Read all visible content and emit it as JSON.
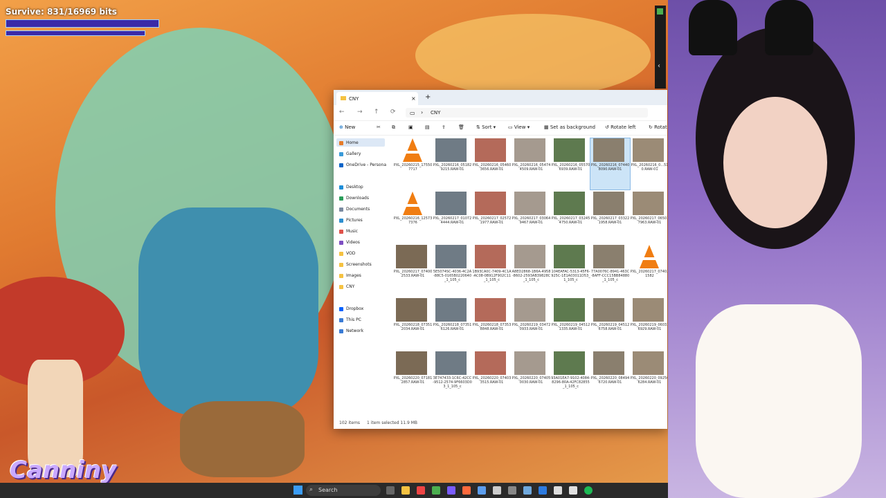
{
  "overlay": {
    "survive_text": "Survive: 831/16969 bits",
    "logo": "Canniny"
  },
  "explorer": {
    "tab_title": "CNY",
    "address": "CNY",
    "toolbar": [
      "New",
      "Sort",
      "View",
      "Set as background",
      "Rotate left",
      "Rotat"
    ],
    "sidebar": [
      "Home",
      "Gallery",
      "OneDrive - Persona",
      "Desktop",
      "Downloads",
      "Documents",
      "Pictures",
      "Music",
      "Videos",
      "VOD",
      "Screenshots",
      "Images",
      "CNY",
      "Dropbox",
      "This PC",
      "Network"
    ],
    "files": [
      "PXL_20260215_175507717",
      "PXL_20260216_051829215.RAW-01",
      "PXL_20260216_054603656.RAW-01",
      "PXL_20260216_054744509.RAW-01",
      "PXL_20260216_055706939.RAW-01",
      "PXL_20260216_074408090.RAW-01",
      "PXL_20260216_0...510.RAW-01",
      "PXL_20260216_125737376",
      "PXL_20260217_010724444.RAW-01",
      "PXL_20260217_025721977.RAW-01",
      "PXL_20260217_030649467.RAW-01",
      "PXL_20260217_032454750.RAW-01",
      "PXL_20260217_033221958.RAW-01",
      "PXL_20260217_065037963.RAW-01",
      "PXL_20260217_074002533.RAW-01",
      "5E5074SC-4036-4C2A-88C5-0165B0220640_1_105_c",
      "1B93CA0C-7409-4C1A-AC08-0B912F902C11_1_105_c",
      "A8ED2868-1B6A-4958-8602-2593AB39828C_1_105_c",
      "104EAFAC-5313-45F6-925C-1E1A03011D53_1_105_c",
      "77A0076C-8941-463C-8AFF-CCC15BB84880_1_105_c",
      "PXL_20260217_074021582",
      "PXL_20260218_073512034.RAW-01",
      "PXL_20260218_073516126.RAW-01",
      "PXL_20260218_073538848.RAW-01",
      "PXL_20260219_034720933.RAW-01",
      "PXL_20260219_045121335.RAW-01",
      "PXL_20260219_045126758.RAW-01",
      "PXL_20260219_060336929.RAW-01",
      "PXL_20260220_071812857.RAW-01",
      "3E747433-1C6C-42CC-9512-2574-9F6603D03_1_105_c",
      "PXL_20260220_074033515.RAW-01",
      "PXL_20260220_074050030.RAW-01",
      "93A01EA7-9102-4084-8296-80A-42FC82855_1_105_c",
      "PXL_20260220_084946720.RAW-01",
      "PXL_20260220_092506284.RAW-01"
    ],
    "status_count": "102 items",
    "status_selected": "1 item selected  11.9 MB"
  },
  "taskbar": {
    "search_placeholder": "Search"
  }
}
